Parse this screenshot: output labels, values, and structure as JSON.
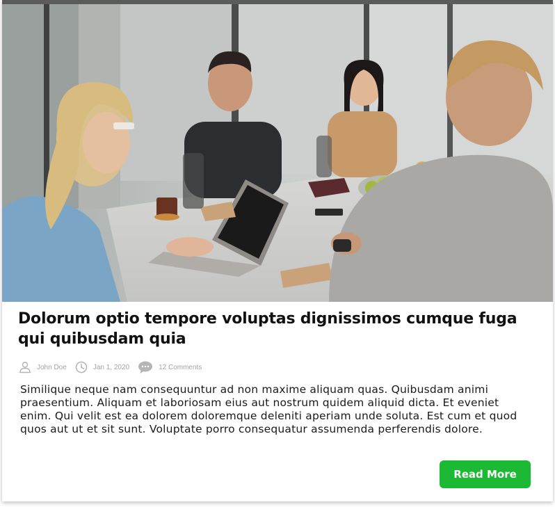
{
  "post": {
    "title": "Dolorum optio tempore voluptas dignissimos cumque fuga qui quibusdam quia",
    "author": "John Doe",
    "date": "Jan 1, 2020",
    "comments": "12 Comments",
    "excerpt": "Similique neque nam consequuntur ad non maxime aliquam quas. Quibusdam animi praesentium. Aliquam et laboriosam eius aut nostrum quidem aliquid dicta. Et eveniet enim. Qui velit est ea dolorem doloremque deleniti aperiam unde soluta. Est cum et quod quos aut ut et sit sunt. Voluptate porro consequatur assumenda perferendis dolore.",
    "read_more_label": "Read More"
  },
  "icons": {
    "author": "user-icon",
    "date": "clock-icon",
    "comments": "comment-icon"
  },
  "colors": {
    "button": "#1bb934",
    "meta_text": "#a3a3a3",
    "title": "#111111"
  }
}
